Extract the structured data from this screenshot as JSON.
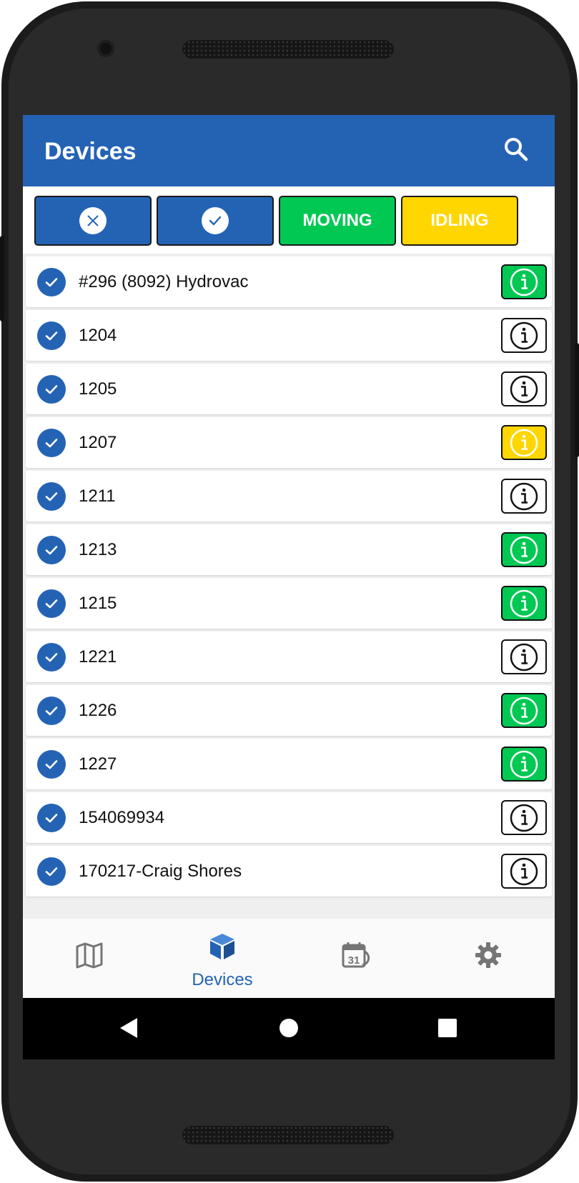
{
  "app_bar": {
    "title": "Devices"
  },
  "filters": [
    {
      "name": "clear-all-filter-button",
      "label": "",
      "icon": "x-icon",
      "bg": "#2463b4"
    },
    {
      "name": "select-all-filter-button",
      "label": "",
      "icon": "check-icon",
      "bg": "#2463b4"
    },
    {
      "name": "moving-filter-button",
      "label": "MOVING",
      "bg": "#00c853"
    },
    {
      "name": "idling-filter-button",
      "label": "IDLING",
      "bg": "#ffd600"
    }
  ],
  "devices": [
    {
      "name": "#296 (8092) Hydrovac",
      "status": "green",
      "checked": true
    },
    {
      "name": "1204",
      "status": "none",
      "checked": true
    },
    {
      "name": "1205",
      "status": "none",
      "checked": true
    },
    {
      "name": "1207",
      "status": "yellow",
      "checked": true
    },
    {
      "name": "1211",
      "status": "none",
      "checked": true
    },
    {
      "name": "1213",
      "status": "green",
      "checked": true
    },
    {
      "name": "1215",
      "status": "green",
      "checked": true
    },
    {
      "name": "1221",
      "status": "none",
      "checked": true
    },
    {
      "name": "1226",
      "status": "green",
      "checked": true
    },
    {
      "name": "1227",
      "status": "green",
      "checked": true
    },
    {
      "name": "154069934",
      "status": "none",
      "checked": true
    },
    {
      "name": "170217-Craig Shores",
      "status": "none",
      "checked": true
    }
  ],
  "bottom_nav": {
    "items": [
      {
        "name": "map",
        "label": "",
        "icon": "map-icon"
      },
      {
        "name": "devices",
        "label": "Devices",
        "icon": "cube-icon",
        "active": true
      },
      {
        "name": "history",
        "label": "",
        "icon": "calendar-icon"
      },
      {
        "name": "settings",
        "label": "",
        "icon": "gear-icon"
      }
    ],
    "calendar_day": "31"
  },
  "colors": {
    "primary": "#2463b4",
    "moving": "#00c853",
    "idling": "#ffd600",
    "inactive_icon": "#757575"
  }
}
